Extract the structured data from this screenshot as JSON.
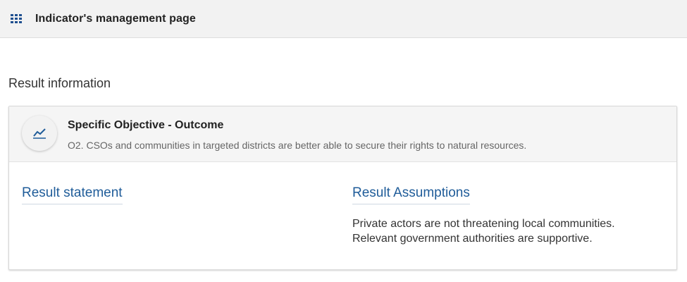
{
  "header": {
    "apps_icon": "grid-icon",
    "title": "Indicator's management page"
  },
  "section": {
    "heading": "Result information"
  },
  "card": {
    "icon": "chart-line-icon",
    "title": "Specific Objective - Outcome",
    "subtitle": "O2. CSOs and communities in targeted districts are better able to secure their rights to natural resources.",
    "result_statement_label": "Result statement",
    "result_assumptions_label": "Result Assumptions",
    "assumptions": [
      "Private actors are not threatening local communities.",
      "Relevant government authorities are supportive."
    ]
  },
  "colors": {
    "accent": "#1f5c99",
    "header_bg": "#f2f2f2"
  }
}
